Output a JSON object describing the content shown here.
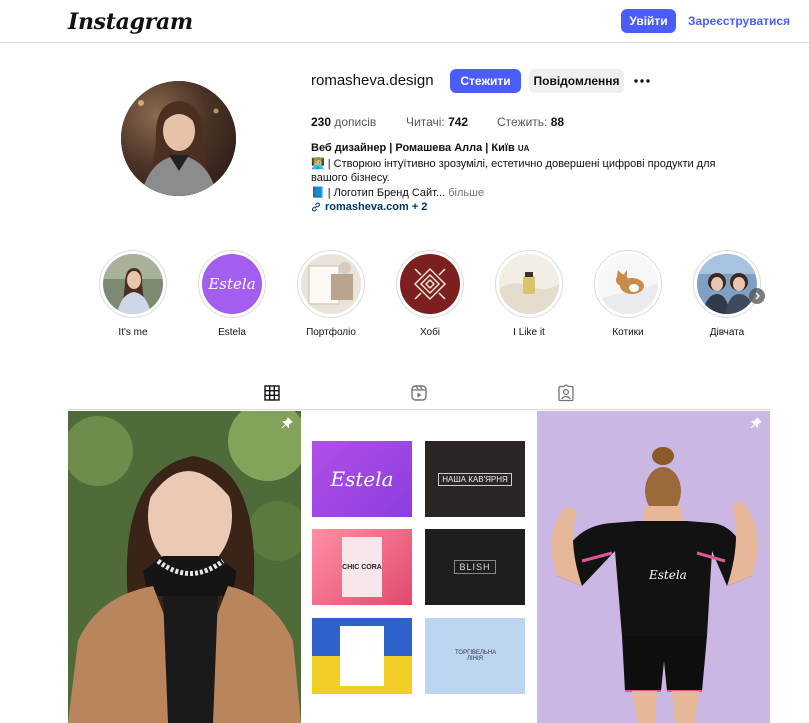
{
  "header": {
    "logo": "Instagram",
    "login_label": "Увійти",
    "signup_label": "Зареєструватися"
  },
  "profile": {
    "username": "romasheva.design",
    "follow_label": "Стежити",
    "message_label": "Повідомлення",
    "more_label": "•••",
    "stats": {
      "posts_count": "230",
      "posts_label": "дописів",
      "followers_label": "Читачі:",
      "followers_count": "742",
      "following_label": "Стежить:",
      "following_count": "88"
    },
    "bio": {
      "name": "Веб дизайнер | Ромашева Алла | Київ",
      "name_suffix": "UA",
      "line1": "👩🏼‍💻 | Створюю інтуїтивно зрозумілі, естетично довершені цифрові продукти для вашого бізнесу.",
      "line2": "📘 | Логотип Бренд Сайт...",
      "more": "більше",
      "link": "romasheva.com + 2"
    }
  },
  "highlights": [
    {
      "label": "It's me"
    },
    {
      "label": "Estela"
    },
    {
      "label": "Портфоліо"
    },
    {
      "label": "Хобі"
    },
    {
      "label": "I Like it"
    },
    {
      "label": "Котики"
    },
    {
      "label": "Дівчата"
    }
  ],
  "highlight_estela_text": "Estela",
  "tabs": [
    {
      "icon": "grid-icon"
    },
    {
      "icon": "reels-icon"
    },
    {
      "icon": "tagged-icon"
    }
  ],
  "grid": {
    "cards": [
      {
        "text": "Estela"
      },
      {
        "text": "НАША КАВ'ЯРНЯ"
      },
      {
        "text": "CHIC CORA"
      },
      {
        "text": "BLISH"
      },
      {
        "text": ""
      },
      {
        "text": "ТОРГІВЕЛЬНА ЛІНІЯ"
      }
    ],
    "shirt_text": "Estela"
  },
  "colors": {
    "accent": "#4a5df9",
    "link": "#00376b"
  }
}
